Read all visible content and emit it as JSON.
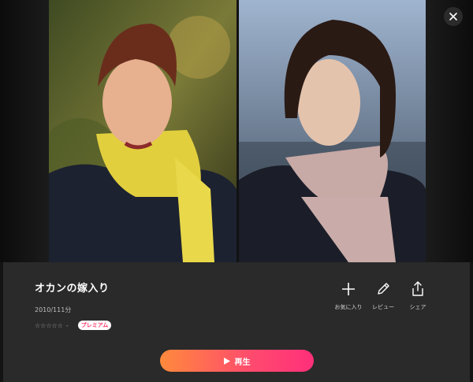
{
  "movie": {
    "title": "オカンの嫁入り",
    "meta": "2010/111分",
    "stars": "☆☆☆☆☆",
    "rating_value": "-",
    "premium_label": "プレミアム"
  },
  "actions": [
    {
      "label": "お気に入り",
      "icon": "plus-icon"
    },
    {
      "label": "レビュー",
      "icon": "pencil-icon"
    },
    {
      "label": "シェア",
      "icon": "share-icon"
    }
  ],
  "play": {
    "label": "再生",
    "icon": "play-icon"
  },
  "close": {
    "icon": "close-icon"
  },
  "colors": {
    "panel": "#2a2a2a",
    "play_gradient_start": "#ff8a3c",
    "play_gradient_end": "#ff2f7a",
    "premium_text": "#ff3b6b"
  }
}
